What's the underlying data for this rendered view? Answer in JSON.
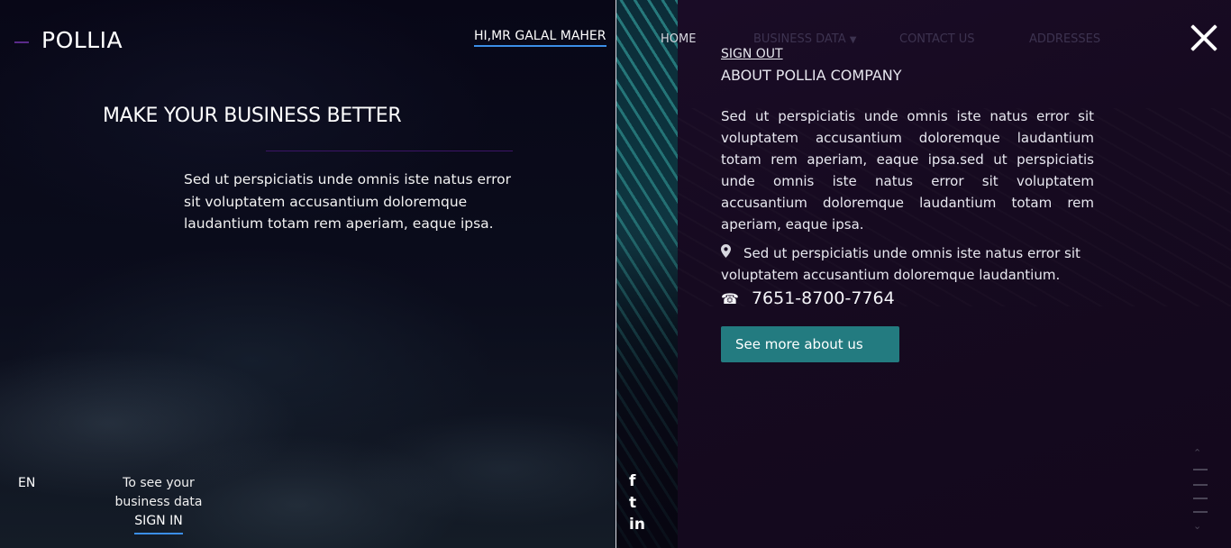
{
  "brand": {
    "name": "POLLIA"
  },
  "user": {
    "greeting": "HI,MR GALAL MAHER"
  },
  "hero": {
    "title": "MAKE YOUR BUSINESS BETTER",
    "text": "Sed ut perspiciatis unde omnis iste natus error sit voluptatem accusantium doloremque laudantium totam rem aperiam, eaque ipsa."
  },
  "footer": {
    "lang": "EN",
    "signin_prompt_line1": "To see your",
    "signin_prompt_line2": "business data",
    "signin_label": "SIGN IN"
  },
  "nav": {
    "home": "HOME",
    "business_data": "BUSINESS DATA",
    "contact": "CONTACT US",
    "addresses": "ADDRESSES"
  },
  "menu": {
    "signout": "SIGN OUT",
    "about_title": "ABOUT POLLIA COMPANY",
    "about_text": "Sed ut perspiciatis unde omnis iste natus error sit voluptatem accusantium doloremque laudantium totam rem aperiam, eaque ipsa.sed ut perspiciatis unde omnis iste natus error sit voluptatem accusantium doloremque laudantium totam rem aperiam, eaque ipsa.",
    "address": "Sed ut perspiciatis unde omnis iste natus error sit voluptatem accusantium doloremque laudantium.",
    "phone": "7651-8700-7764",
    "cta": "See more about us"
  },
  "social": {
    "facebook": "f",
    "tumblr": "t",
    "linkedin": "in"
  },
  "icons": [
    "close-icon",
    "location-pin-icon",
    "phone-icon",
    "chevron-down-icon",
    "facebook-icon",
    "tumblr-icon",
    "linkedin-icon",
    "chevron-up-icon"
  ],
  "colors": {
    "accent_blue": "#3b8ee6",
    "teal_button": "#237b80",
    "purple_rule": "#3b1466"
  }
}
